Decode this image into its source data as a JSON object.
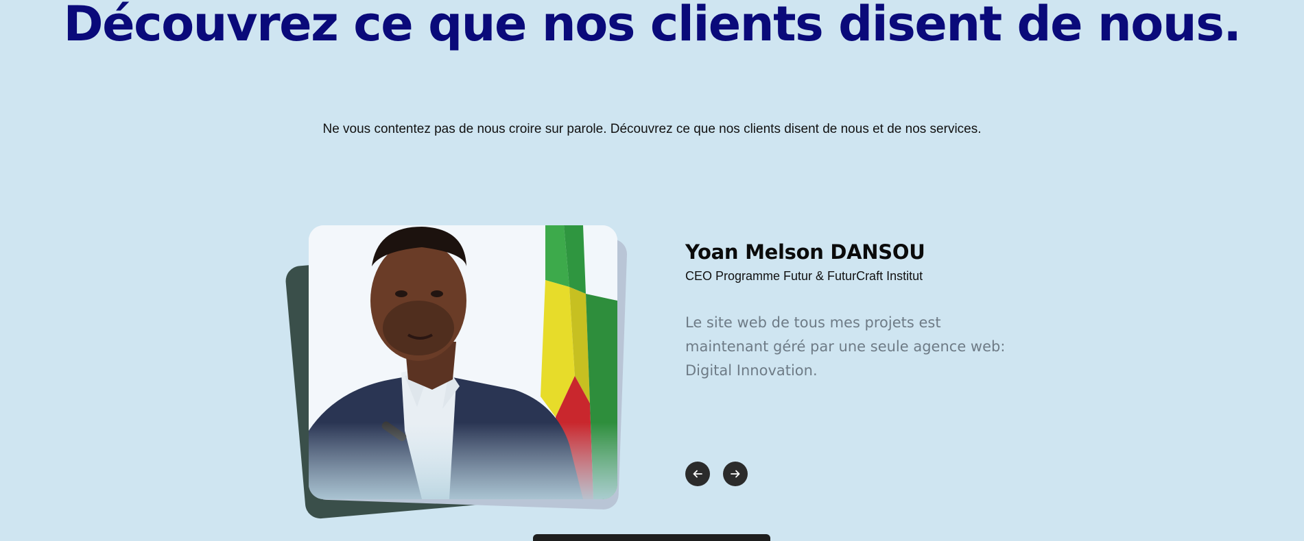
{
  "section": {
    "headline": "Découvrez ce que nos clients disent de nous.",
    "subtitle": "Ne vous contentez pas de nous croire sur parole. Découvrez ce que nos clients disent de nous et de nos services."
  },
  "testimonial": {
    "name": "Yoan Melson DANSOU",
    "role": "CEO Programme Futur & FuturCraft Institut",
    "quote": "Le site web de tous mes projets est maintenant géré par une seule agence web: Digital Innovation.",
    "photo_alt": "Yoan Melson DANSOU"
  },
  "navigation": {
    "prev_icon": "arrow-left-icon",
    "next_icon": "arrow-right-icon"
  },
  "colors": {
    "background": "#cfe5f1",
    "headline": "#0a0a7a",
    "nav_button": "#2b2b2b",
    "quote_text": "#6e7b86"
  }
}
